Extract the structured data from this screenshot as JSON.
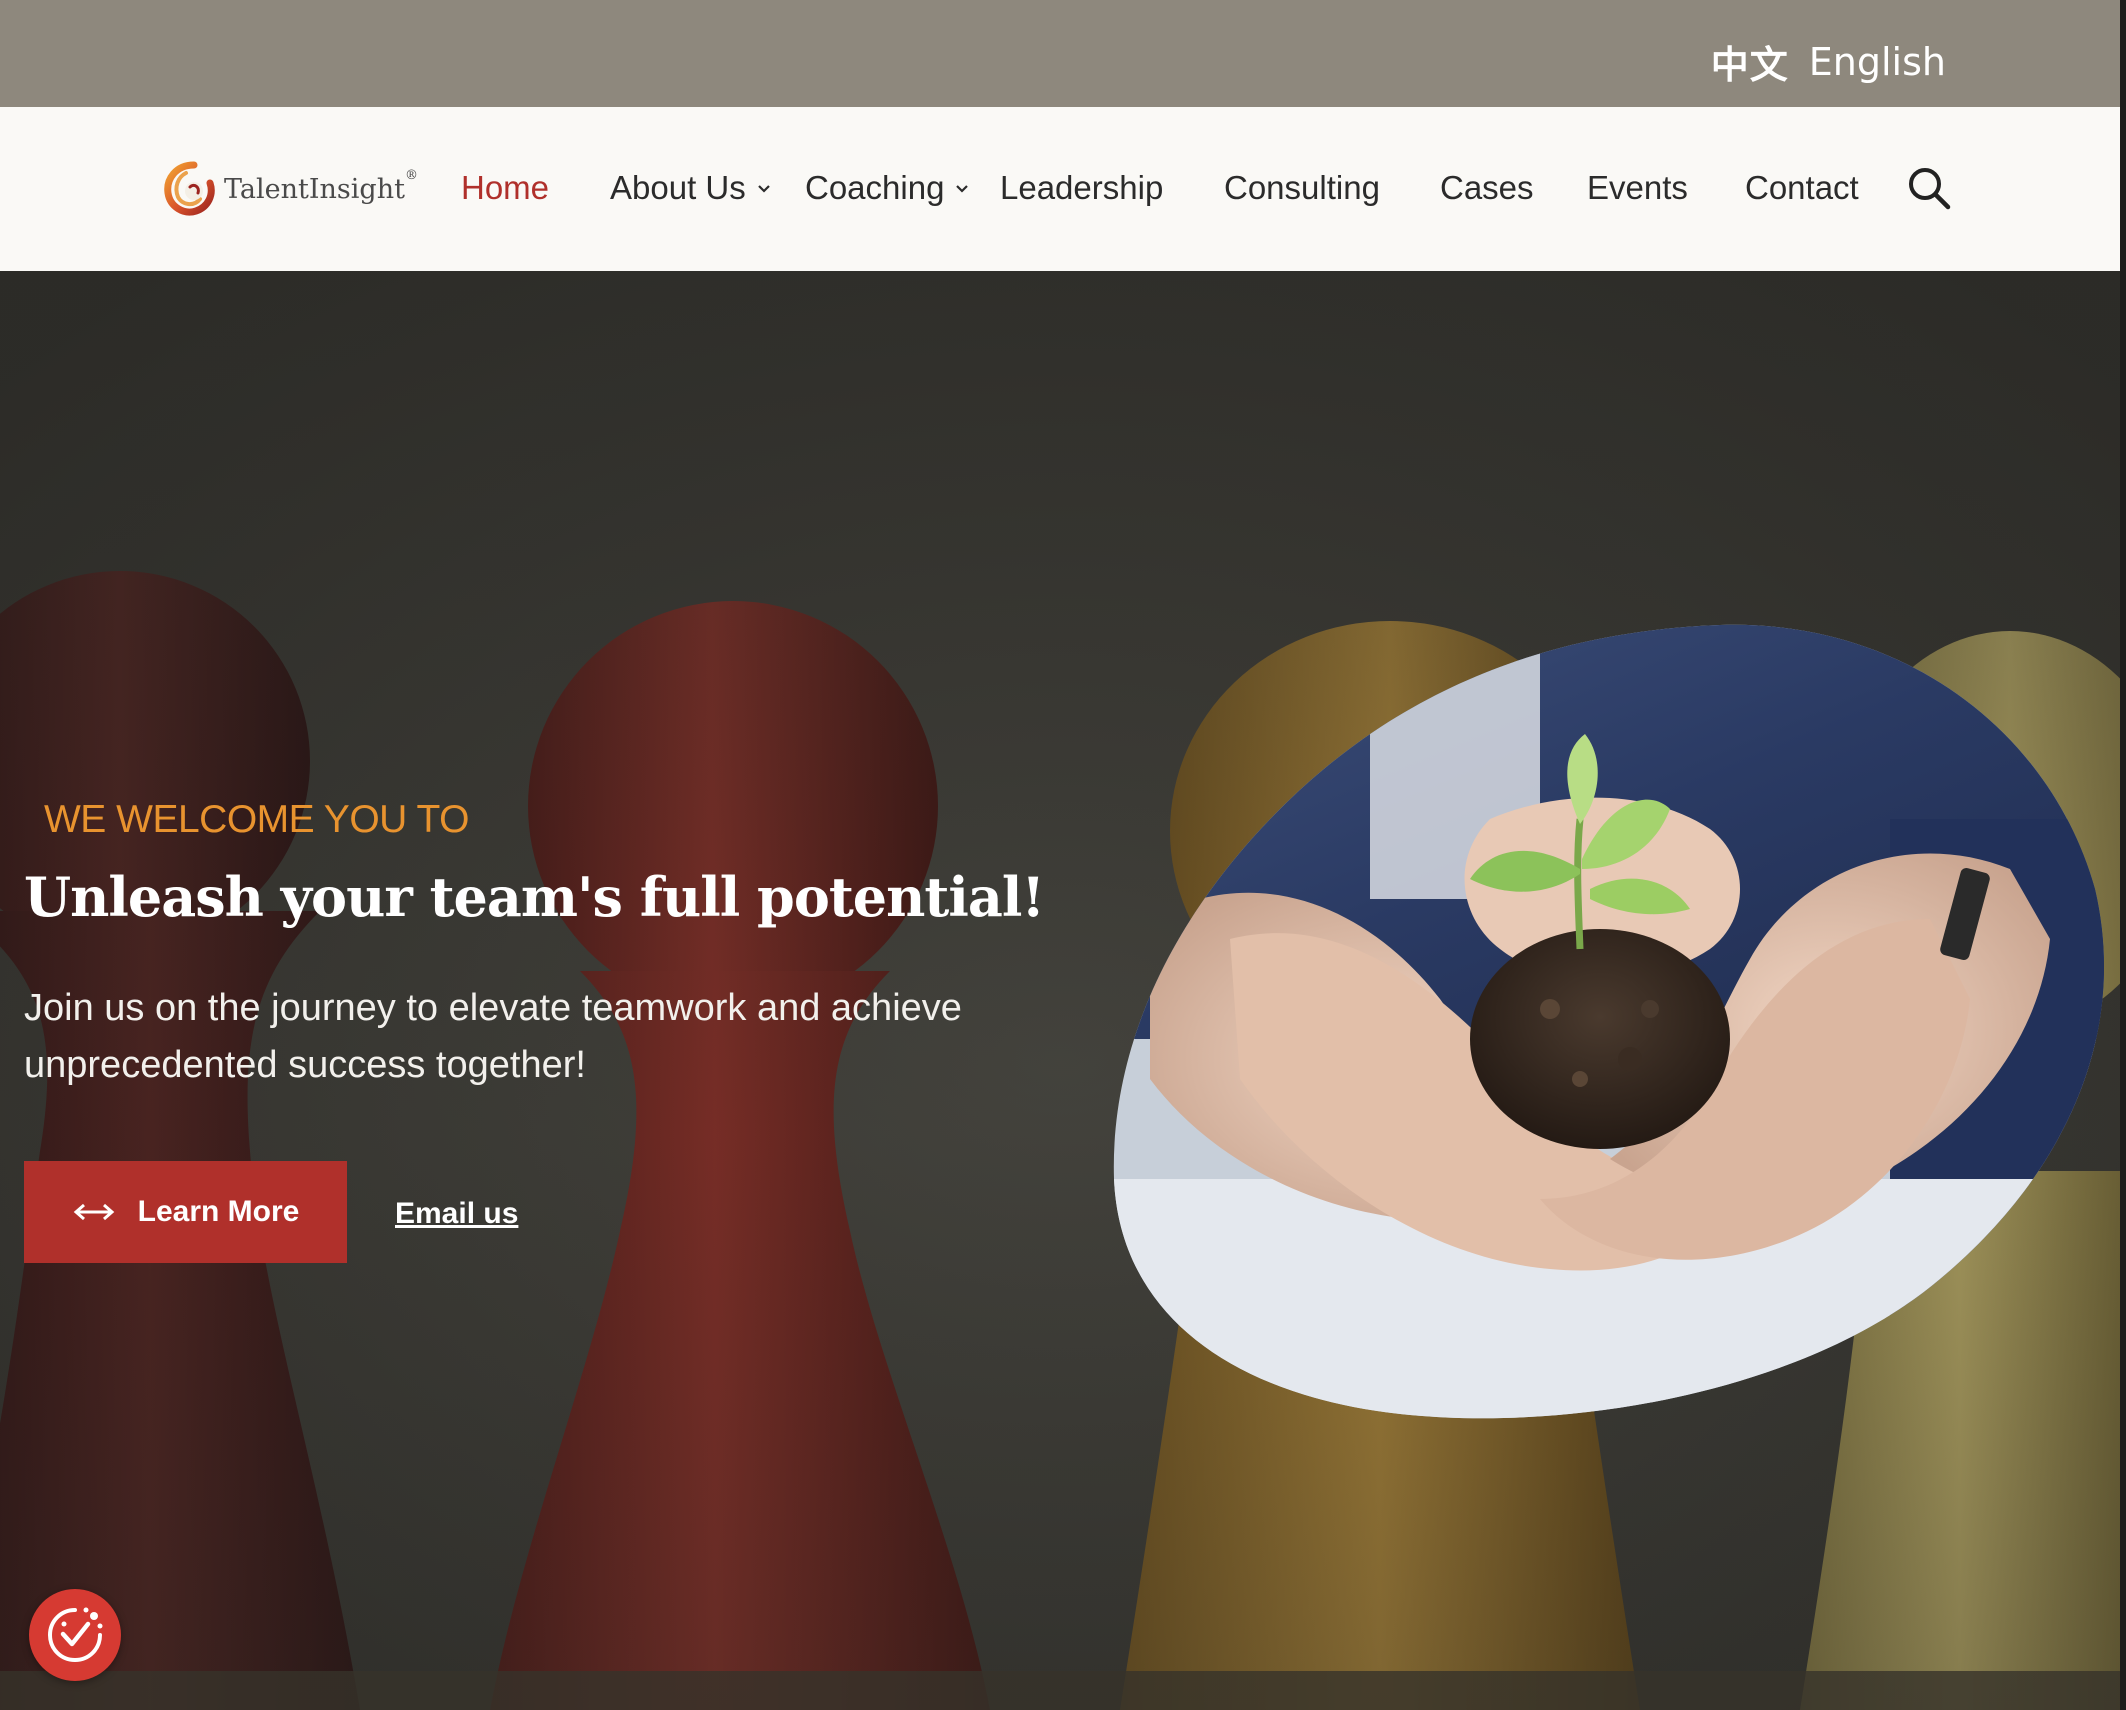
{
  "top_bar": {
    "lang_zh": "中文",
    "lang_en": "English"
  },
  "brand": {
    "name": "TalentInsight",
    "registered_mark": "®",
    "logo_icon": "circular-swirl-logo-icon",
    "accent_color": "#b0302b",
    "orange_color": "#e8932f"
  },
  "nav": {
    "items": [
      {
        "label": "Home",
        "active": true,
        "dropdown": false
      },
      {
        "label": "About Us",
        "active": false,
        "dropdown": true
      },
      {
        "label": "Coaching",
        "active": false,
        "dropdown": true
      },
      {
        "label": "Leadership",
        "active": false,
        "dropdown": false
      },
      {
        "label": "Consulting",
        "active": false,
        "dropdown": false
      },
      {
        "label": "Cases",
        "active": false,
        "dropdown": false
      },
      {
        "label": "Events",
        "active": false,
        "dropdown": false
      },
      {
        "label": "Contact",
        "active": false,
        "dropdown": false
      }
    ],
    "search_icon": "search-icon"
  },
  "hero": {
    "eyebrow": "WE WELCOME YOU TO",
    "headline": "Unleash your team's full potential!",
    "subtext": "Join us on the journey to elevate teamwork and achieve unprecedented success together!",
    "primary_button": "Learn More",
    "primary_button_icon": "horizontal-arrows-icon",
    "secondary_link": "Email us",
    "background_image": "wooden-pawn-figures",
    "feature_image": "hands-holding-seedling-in-soil"
  },
  "consent_badge_icon": "cookie-consent-check-icon"
}
